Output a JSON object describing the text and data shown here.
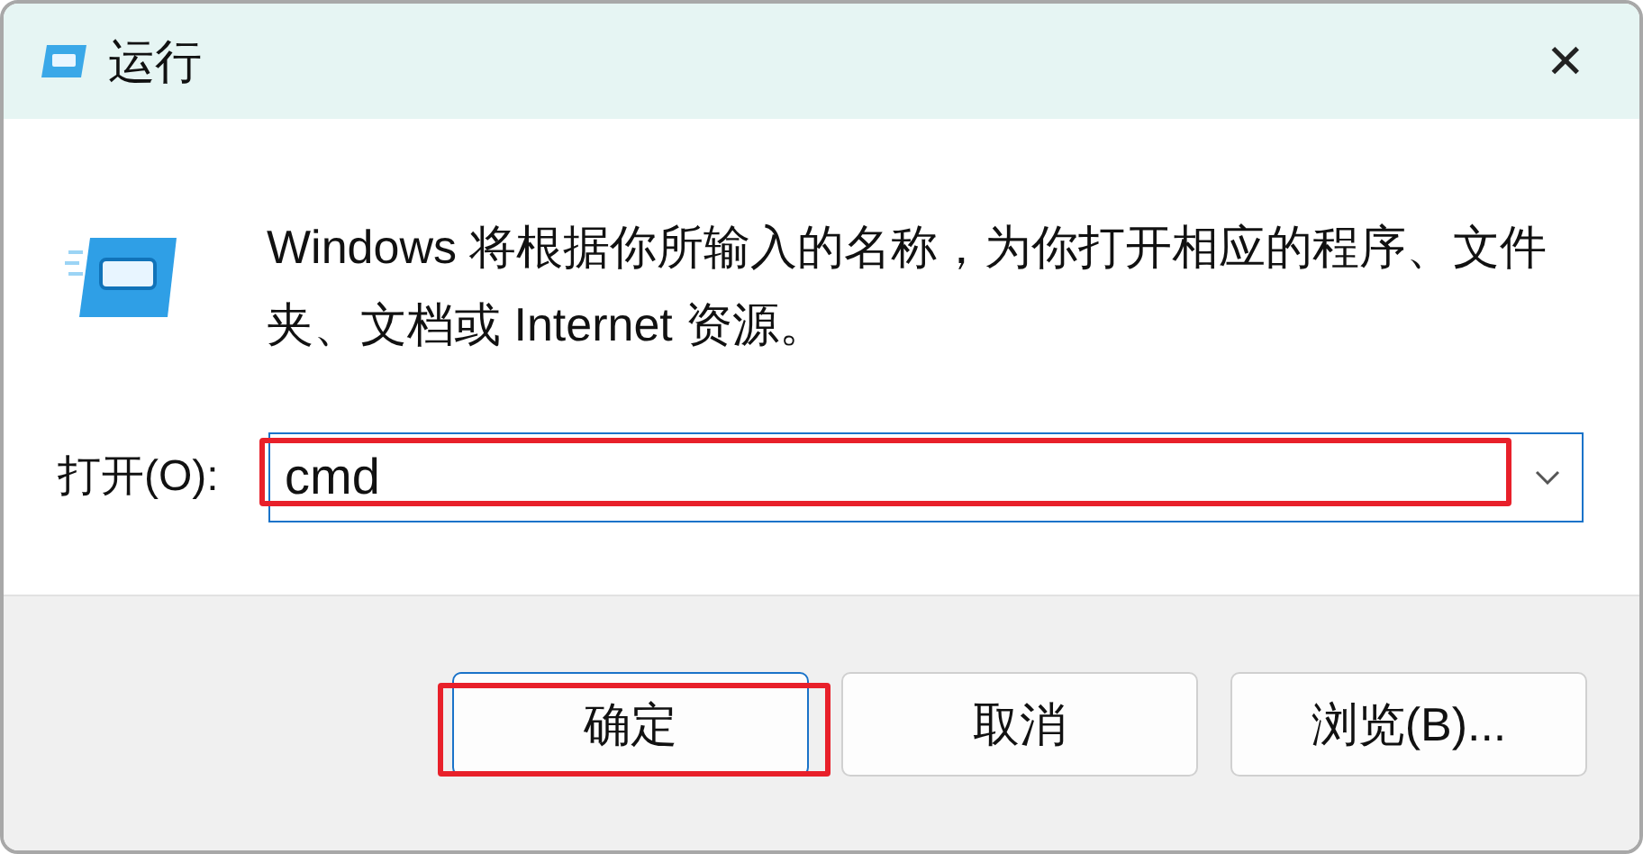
{
  "window": {
    "title": "运行",
    "close": "✕"
  },
  "message": "Windows 将根据你所输入的名称，为你打开相应的程序、文件夹、文档或 Internet 资源。",
  "open_field": {
    "label": "打开(O):",
    "value": "cmd",
    "highlighted": true
  },
  "buttons": [
    {
      "label": "确定",
      "default": true,
      "highlighted": true
    },
    {
      "label": "取消",
      "default": false,
      "highlighted": false
    },
    {
      "label": "浏览(B)...",
      "default": false,
      "highlighted": false
    }
  ]
}
